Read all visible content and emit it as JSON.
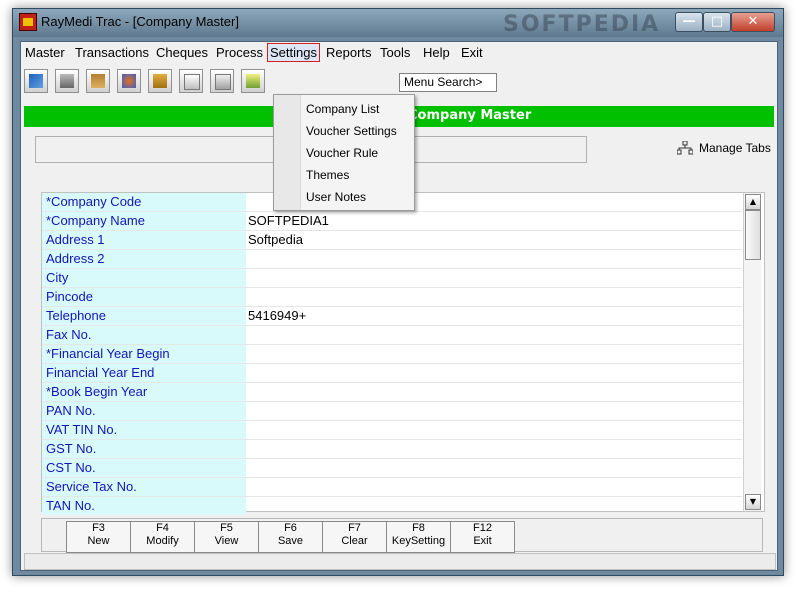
{
  "window": {
    "title": "RayMedi Trac - [Company Master]",
    "watermark": "SOFTPEDIA",
    "minimize": "—",
    "maximize": "□",
    "close": "✕"
  },
  "menubar": {
    "items": [
      "Master",
      "Transactions",
      "Cheques",
      "Process",
      "Settings",
      "Reports",
      "Tools",
      "Help",
      "Exit"
    ]
  },
  "toolbar": {
    "icons": [
      "book-icon",
      "printer-icon",
      "building-icon",
      "users-icon",
      "boxes-icon",
      "documents-icon",
      "gear-document-icon",
      "notes-icon"
    ],
    "menu_search": "Menu Search>"
  },
  "settings_menu": {
    "items": [
      "Company List",
      "Voucher Settings",
      "Voucher Rule",
      "Themes",
      "User Notes"
    ]
  },
  "banner": {
    "title": "Company Master"
  },
  "manage_tabs": "Manage Tabs",
  "form": {
    "rows": [
      {
        "label": "*Company Code",
        "value": ""
      },
      {
        "label": "*Company Name",
        "value": "SOFTPEDIA1"
      },
      {
        "label": " Address 1",
        "value": "Softpedia"
      },
      {
        "label": " Address 2",
        "value": ""
      },
      {
        "label": " City",
        "value": ""
      },
      {
        "label": " Pincode",
        "value": ""
      },
      {
        "label": " Telephone",
        "value": "5416949+"
      },
      {
        "label": " Fax No.",
        "value": ""
      },
      {
        "label": "*Financial Year Begin",
        "value": ""
      },
      {
        "label": " Financial Year End",
        "value": ""
      },
      {
        "label": "*Book Begin Year",
        "value": ""
      },
      {
        "label": " PAN No.",
        "value": ""
      },
      {
        "label": " VAT TIN No.",
        "value": ""
      },
      {
        "label": " GST No.",
        "value": ""
      },
      {
        "label": " CST No.",
        "value": ""
      },
      {
        "label": " Service Tax No.",
        "value": ""
      },
      {
        "label": " TAN No.",
        "value": ""
      }
    ]
  },
  "scroll": {
    "up": "▲",
    "down": "▼"
  },
  "fkeys": [
    {
      "key": "F3",
      "label": "New"
    },
    {
      "key": "F4",
      "label": "Modify"
    },
    {
      "key": "F5",
      "label": "View"
    },
    {
      "key": "F6",
      "label": "Save"
    },
    {
      "key": "F7",
      "label": "Clear"
    },
    {
      "key": "F8",
      "label": "KeySetting"
    },
    {
      "key": "F12",
      "label": "Exit"
    }
  ],
  "colors": {
    "banner_green": "#00c000",
    "label_cyan": "#d9fafa",
    "label_text_blue": "#1414b4",
    "title_bar": "#6f8aa0"
  }
}
